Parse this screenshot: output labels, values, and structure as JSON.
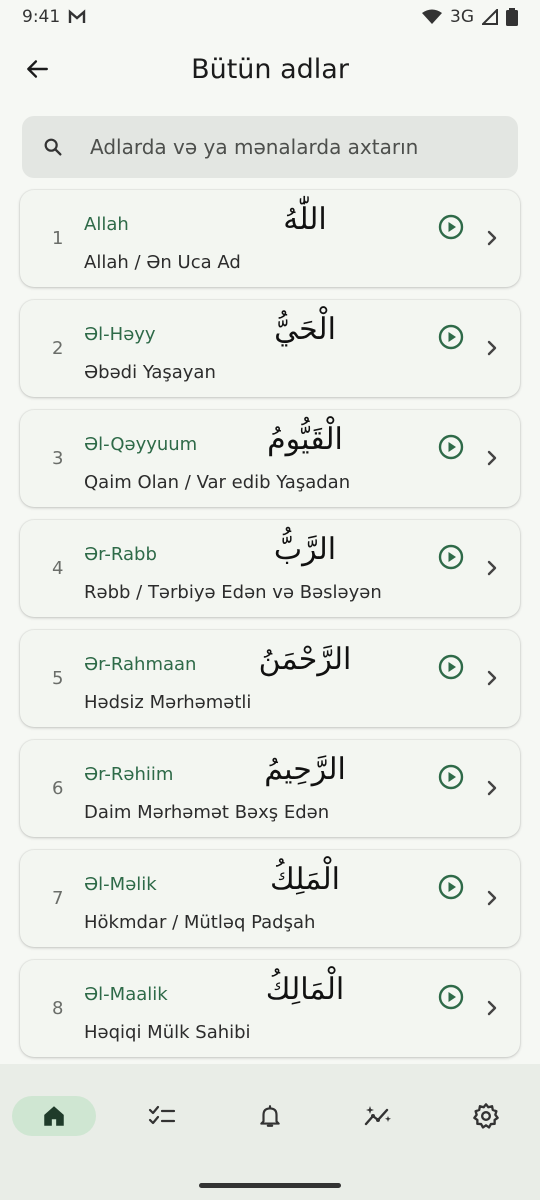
{
  "status_bar": {
    "time": "9:41",
    "network": "3G"
  },
  "header": {
    "title": "Bütün adlar"
  },
  "search": {
    "placeholder": "Adlarda və ya mənalarda axtarın"
  },
  "items": [
    {
      "number": "1",
      "translit": "Allah",
      "arabic": "اللّٰهُ",
      "meaning": "Allah / Ən Uca Ad"
    },
    {
      "number": "2",
      "translit": "Əl-Həyy",
      "arabic": "الْحَيُّ",
      "meaning": "Əbədi Yaşayan"
    },
    {
      "number": "3",
      "translit": "Əl-Qəyyuum",
      "arabic": "الْقَيُّومُ",
      "meaning": "Qaim Olan / Var edib Yaşadan"
    },
    {
      "number": "4",
      "translit": "Ər-Rabb",
      "arabic": "الرَّبُّ",
      "meaning": "Rəbb / Tərbiyə Edən və Bəsləyən"
    },
    {
      "number": "5",
      "translit": "Ər-Rahmaan",
      "arabic": "الرَّحْمَنُ",
      "meaning": "Hədsiz Mərhəmətli"
    },
    {
      "number": "6",
      "translit": "Ər-Rəhiim",
      "arabic": "الرَّحِيمُ",
      "meaning": "Daim Mərhəmət Bəxş Edən"
    },
    {
      "number": "7",
      "translit": "Əl-Məlik",
      "arabic": "الْمَلِكُ",
      "meaning": "Hökmdar / Mütləq Padşah"
    },
    {
      "number": "8",
      "translit": "Əl-Maalik",
      "arabic": "الْمَالِكُ",
      "meaning": "Həqiqi Mülk Sahibi"
    }
  ],
  "colors": {
    "accent": "#2e6a48",
    "background": "#f6f8f4",
    "nav_active": "#cfe6d2"
  },
  "bottom_nav": {
    "items": [
      {
        "icon": "home-icon",
        "active": true
      },
      {
        "icon": "checklist-icon",
        "active": false
      },
      {
        "icon": "bell-icon",
        "active": false
      },
      {
        "icon": "sparkle-chart-icon",
        "active": false
      },
      {
        "icon": "settings-gear-icon",
        "active": false
      }
    ]
  }
}
